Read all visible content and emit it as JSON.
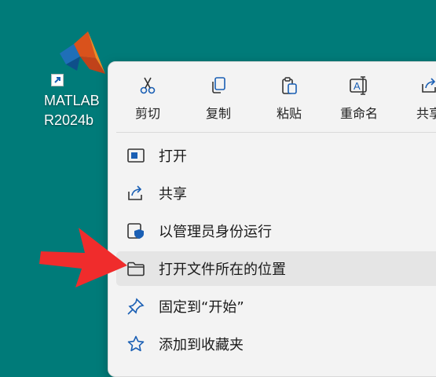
{
  "desktop_icon": {
    "line1": "MATLAB",
    "line2": "R2024b"
  },
  "quick_actions": [
    {
      "label": "剪切",
      "icon": "scissors-icon"
    },
    {
      "label": "复制",
      "icon": "copy-icon"
    },
    {
      "label": "粘贴",
      "icon": "paste-icon"
    },
    {
      "label": "重命名",
      "icon": "rename-icon"
    },
    {
      "label": "共享",
      "icon": "share-icon"
    }
  ],
  "menu_items": [
    {
      "label": "打开",
      "icon": "open-app-icon"
    },
    {
      "label": "共享",
      "icon": "share-icon"
    },
    {
      "label": "以管理员身份运行",
      "icon": "admin-shield-icon"
    },
    {
      "label": "打开文件所在的位置",
      "icon": "folder-icon"
    },
    {
      "label": "固定到“开始”",
      "icon": "pin-icon"
    },
    {
      "label": "添加到收藏夹",
      "icon": "star-icon"
    }
  ],
  "colors": {
    "desktop_bg": "#007b79",
    "menu_bg": "#f3f3f3",
    "icon_blue": "#1a5fb4",
    "highlight_arrow": "#f02c2c"
  }
}
